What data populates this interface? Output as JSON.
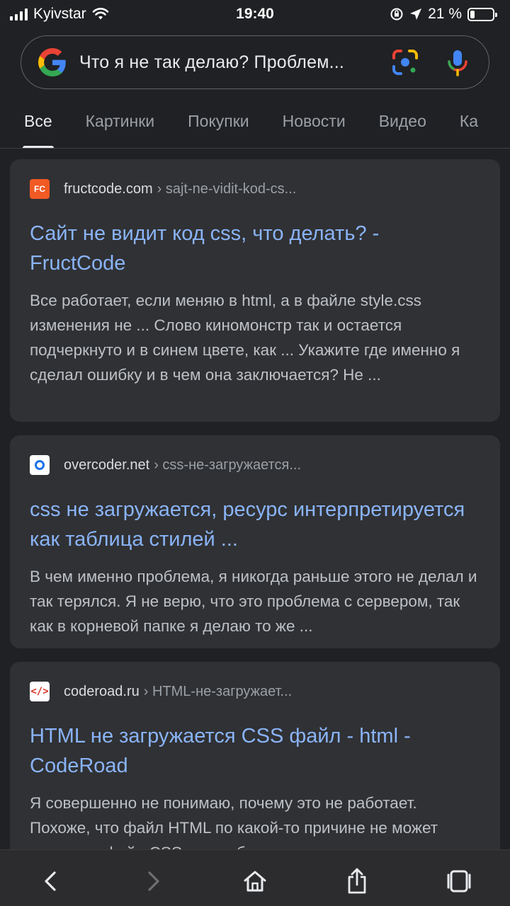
{
  "status_bar": {
    "carrier": "Kyivstar",
    "time": "19:40",
    "battery_percent": "21 %",
    "battery_level": 0.21
  },
  "search": {
    "query": "Что я не так делаю? Проблем..."
  },
  "tabs": [
    {
      "label": "Все",
      "active": true
    },
    {
      "label": "Картинки",
      "active": false
    },
    {
      "label": "Покупки",
      "active": false
    },
    {
      "label": "Новости",
      "active": false
    },
    {
      "label": "Видео",
      "active": false
    },
    {
      "label": "Ка",
      "active": false
    }
  ],
  "results": [
    {
      "favicon": "FC",
      "domain": "fructcode.com",
      "path": "› sajt-ne-vidit-kod-cs...",
      "title": "Сайт не видит код css, что делать? - FructCode",
      "snippet": "Все работает, если меняю в html, а в файле style.css изменения не ... Слово киномонстр так и остается подчеркнуто и в синем цвете, как ... Укажите где именно я сделал ошибку и в чем она заключается? Не ..."
    },
    {
      "favicon": "o",
      "domain": "overcoder.net",
      "path": "› css-не-загружается...",
      "title": "css не загружается, ресурс интерпретируется как таблица стилей ...",
      "snippet": "В чем именно проблема, я никогда раньше этого не делал и так терялся. Я не верю, что это проблема с сервером, так как в корневой папке я делаю то же ..."
    },
    {
      "favicon": "</>",
      "domain": "coderoad.ru",
      "path": "› HTML-не-загружает...",
      "title": "HTML не загружается CSS файл - html - CodeRoad",
      "snippet": "Я совершенно не понимаю, почему это не работает. Похоже, что файл HTML по какой-то причине не может загрузить файл CSS, хотя оба находятся в"
    }
  ],
  "colors": {
    "background": "#202124",
    "card": "#303134",
    "link": "#8ab4f8",
    "snippet": "#bdc1c6"
  },
  "icons": {
    "back": "chevron-left-icon",
    "forward": "chevron-right-icon",
    "home": "home-icon",
    "share": "share-icon",
    "tabs": "tabs-icon"
  }
}
